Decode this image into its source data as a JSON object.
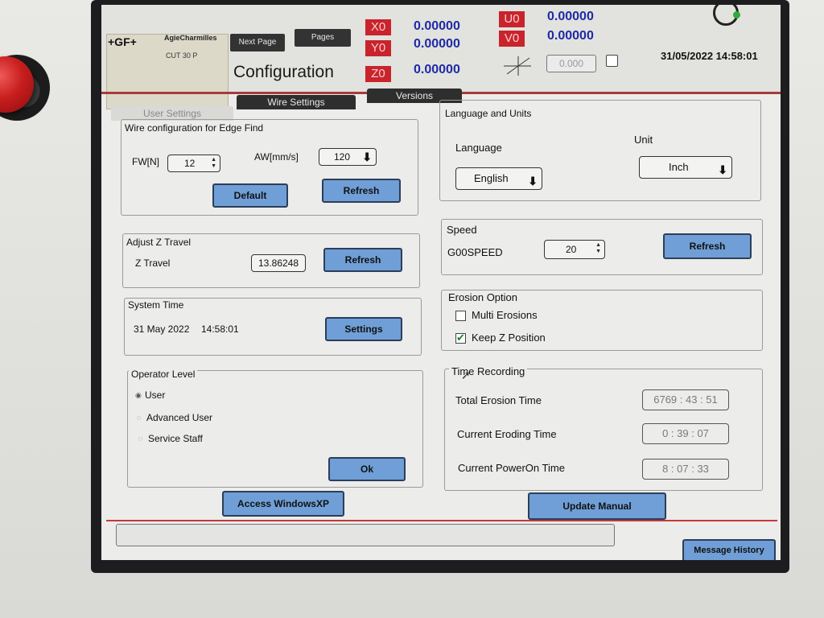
{
  "header": {
    "logo": "+GF+",
    "brand": "AgieCharmilles",
    "model": "CUT 30 P",
    "next_page": "Next Page",
    "pages": "Pages",
    "title": "Configuration",
    "axes": [
      {
        "name": "X0",
        "value": "0.00000"
      },
      {
        "name": "Y0",
        "value": "0.00000"
      },
      {
        "name": "Z0",
        "value": "0.00000"
      },
      {
        "name": "U0",
        "value": "0.00000"
      },
      {
        "name": "V0",
        "value": "0.00000"
      }
    ],
    "readout": "0.000",
    "datetime": "31/05/2022 14:58:01"
  },
  "tabs": [
    "User Settings",
    "Wire Settings",
    "Versions"
  ],
  "wire_config": {
    "title": "Wire configuration for Edge Find",
    "fw_label": "FW[N]",
    "fw_value": "12",
    "aw_label": "AW[mm/s]",
    "aw_value": "120",
    "default_label": "Default",
    "refresh_label": "Refresh"
  },
  "z_travel": {
    "title": "Adjust Z Travel",
    "label": "Z Travel",
    "value": "13.86248",
    "refresh_label": "Refresh"
  },
  "system_time": {
    "title": "System Time",
    "date": "31 May 2022",
    "time": "14:58:01",
    "settings_label": "Settings"
  },
  "operator": {
    "title": "Operator Level",
    "options": [
      "User",
      "Advanced User",
      "Service Staff"
    ],
    "selected": "User",
    "ok_label": "Ok"
  },
  "access_label": "Access WindowsXP",
  "language_units": {
    "title": "Language and Units",
    "language_label": "Language",
    "language_value": "English",
    "unit_label": "Unit",
    "unit_value": "Inch"
  },
  "speed": {
    "title": "Speed",
    "label": "G00SPEED",
    "value": "20",
    "refresh_label": "Refresh"
  },
  "erosion": {
    "title": "Erosion Option",
    "multi_label": "Multi Erosions",
    "multi_checked": false,
    "keepz_label": "Keep Z Position",
    "keepz_checked": true
  },
  "time_recording": {
    "title": "Time Recording",
    "rows": [
      {
        "label": "Total Erosion Time",
        "value": "6769 : 43 : 51"
      },
      {
        "label": "Current Eroding Time",
        "value": "0 : 39 : 07"
      },
      {
        "label": "Current PowerOn Time",
        "value": "8 : 07 : 33"
      }
    ]
  },
  "update_manual_label": "Update Manual",
  "message_history_label": "Message History",
  "colors": {
    "button": "#6f9fd6",
    "axis": "#c9232c",
    "axis_value": "#1e2aa8",
    "redline": "#a93b3b"
  }
}
